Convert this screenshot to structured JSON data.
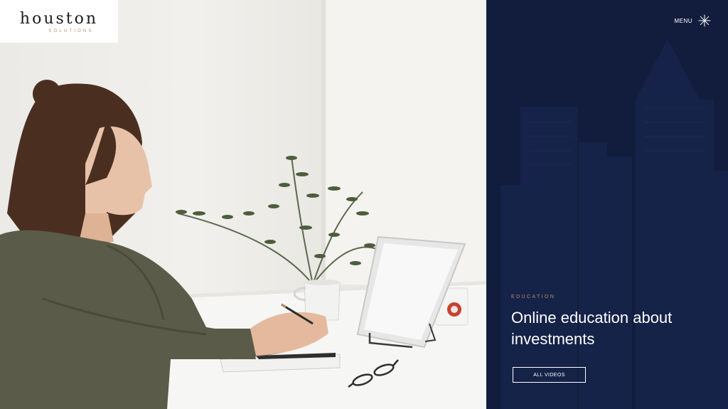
{
  "brand": {
    "name": "houston",
    "tagline": "SOLUTIONS"
  },
  "nav": {
    "menu_label": "MENU",
    "menu_icon": "asterisk-menu-icon"
  },
  "hero": {
    "eyebrow": "EDUCATION",
    "headline": "Online education about investments",
    "cta_label": "ALL VIDEOS"
  },
  "colors": {
    "panel_bg": "#121d3e",
    "accent_gold": "#b58f65",
    "logo_bg": "#ffffff",
    "text_light": "#ffffff"
  }
}
